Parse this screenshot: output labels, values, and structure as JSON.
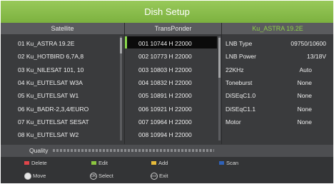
{
  "title": "Dish Setup",
  "columns": {
    "satellite": "Satellite",
    "transponder": "TransPonder",
    "current": "Ku_ASTRA 19.2E"
  },
  "satellites": [
    "01 Ku_ASTRA 19.2E",
    "02 Ku_HOTBIRD 6,7A,8",
    "03 Ku_NILESAT 101, 10",
    "04 Ku_EUTELSAT W3A",
    "05 Ku_EUTELSAT W1",
    "06 Ku_BADR-2,3,4/EURO",
    "07 Ku_EUTELSAT SESAT",
    "08 Ku_EUTELSAT W2"
  ],
  "transponders": [
    "001 10744 H 22000",
    "002 10773 H 22000",
    "003 10803 H 22000",
    "004 10832 H 22000",
    "005 10891 H 22000",
    "006 10921 H 22000",
    "007 10964 H 22000",
    "008 10994 H 22000"
  ],
  "settings": [
    {
      "label": "LNB Type",
      "value": "09750/10600"
    },
    {
      "label": "LNB Power",
      "value": "13/18V"
    },
    {
      "label": "22KHz",
      "value": "Auto"
    },
    {
      "label": "Toneburst",
      "value": "None"
    },
    {
      "label": "DiSEqC1.0",
      "value": "None"
    },
    {
      "label": "DiSEqC1.1",
      "value": "None"
    },
    {
      "label": "Motor",
      "value": "None"
    }
  ],
  "quality_label": "Quality",
  "keys": {
    "delete": "Delete",
    "edit": "Edit",
    "add": "Add",
    "scan": "Scan",
    "move": "Move",
    "select": "Select",
    "exit": "Exit",
    "select_icon_text": "OK",
    "exit_icon_text": "EXIT"
  },
  "colors": {
    "accent": "#8cc34e",
    "red": "#e0454a",
    "green": "#8cc640",
    "yellow": "#e7bb3a",
    "blue": "#2f61b8"
  }
}
